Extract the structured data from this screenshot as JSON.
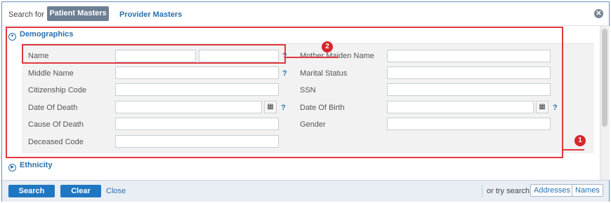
{
  "header": {
    "search_for_label": "Search for",
    "tabs": [
      {
        "label": "Patient Masters",
        "active": true
      },
      {
        "label": "Provider Masters",
        "active": false
      }
    ]
  },
  "sections": {
    "demographics": "Demographics",
    "ethnicity": "Ethnicity"
  },
  "form": {
    "left": {
      "name": "Name",
      "middle_name": "Middle Name",
      "citizenship_code": "Citizenship Code",
      "date_of_death": "Date Of Death",
      "cause_of_death": "Cause Of Death",
      "deceased_code": "Deceased Code"
    },
    "right": {
      "mother_maiden_name": "Mother Maiden Name",
      "marital_status": "Marital Status",
      "ssn": "SSN",
      "date_of_birth": "Date Of Birth",
      "gender": "Gender"
    },
    "help_glyph": "?"
  },
  "footer": {
    "search_label": "Search",
    "clear_label": "Clear",
    "close_label": "Close",
    "or_try_search": "or try search",
    "addresses_label": "Addresses",
    "names_label": "Names"
  },
  "annotations": {
    "badge_1": "1",
    "badge_2": "2",
    "color": "#e0393e"
  },
  "icons": [
    "close-icon",
    "collapse-icon",
    "expand-icon",
    "calendar-icon",
    "help-icon"
  ]
}
